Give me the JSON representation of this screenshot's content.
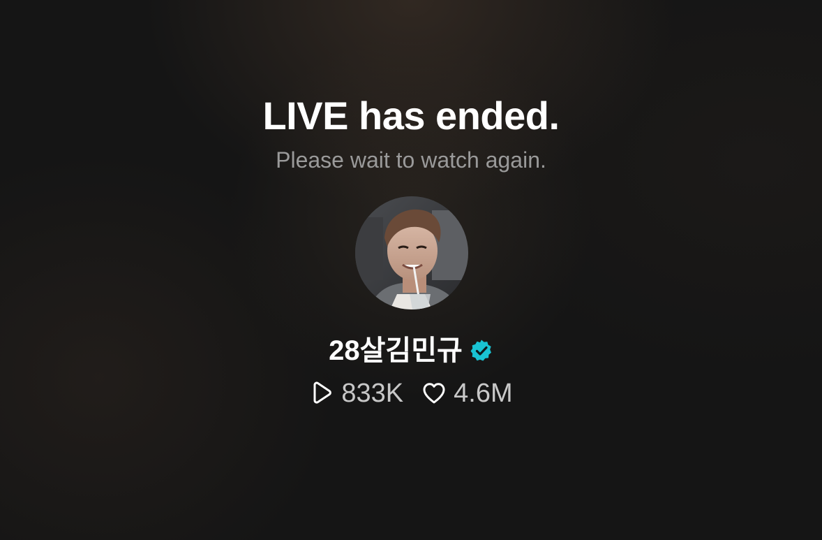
{
  "status": {
    "title": "LIVE has ended.",
    "subtitle": "Please wait to watch again."
  },
  "profile": {
    "avatar_icon": "profile-photo",
    "name": "28살김민규",
    "verified_icon": "verified-badge-icon",
    "verified_color": "#19c3d3"
  },
  "stats": {
    "plays": {
      "icon": "play-icon",
      "value": "833K"
    },
    "likes": {
      "icon": "heart-icon",
      "value": "4.6M"
    }
  }
}
